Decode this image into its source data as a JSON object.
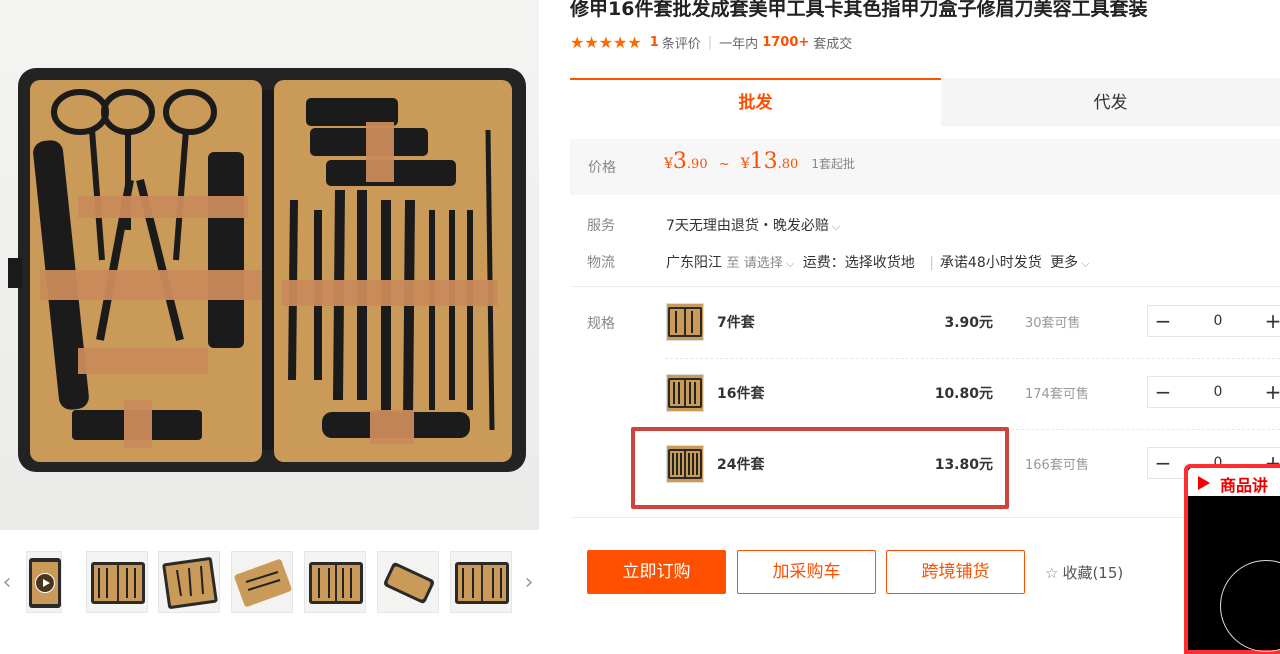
{
  "product": {
    "title": "修甲16件套批发成套美甲工具卡其色指甲刀盒子修眉刀美容工具套装",
    "stars": "★★★★★",
    "review_count": "1",
    "review_label": "条评价",
    "period": "一年内",
    "deal_count": "1700+",
    "deal_label": "套成交"
  },
  "tabs": [
    {
      "label": "批发",
      "active": true
    },
    {
      "label": "代发",
      "active": false
    }
  ],
  "price": {
    "label": "价格",
    "currency": "¥",
    "min_int": "3",
    "min_dec": ".90",
    "tilde": "~",
    "max_int": "13",
    "max_dec": ".80",
    "min_order": "1套起批"
  },
  "service": {
    "label": "服务",
    "value": "7天无理由退货・晚发必赔"
  },
  "logistics": {
    "label": "物流",
    "origin": "广东阳江",
    "to": "至",
    "select": "请选择",
    "freight": "运费：选择收货地",
    "promise": "承诺48小时发货",
    "more": "更多"
  },
  "spec": {
    "label": "规格",
    "items": [
      {
        "name": "7件套",
        "price": "3.90元",
        "stock": "30套可售",
        "qty": "0"
      },
      {
        "name": "16件套",
        "price": "10.80元",
        "stock": "174套可售",
        "qty": "0"
      },
      {
        "name": "24件套",
        "price": "13.80元",
        "stock": "166套可售",
        "qty": "0"
      }
    ],
    "minus": "−",
    "plus": "+"
  },
  "actions": {
    "buy": "立即订购",
    "cart": "加采购车",
    "distribute": "跨境铺货",
    "favorite": "收藏(15)"
  },
  "video_widget": {
    "label": "商品讲"
  },
  "gallery": {
    "prev": "‹",
    "next": "›"
  },
  "colors": {
    "accent": "#ff5000",
    "highlight_border": "#d0443c",
    "case_leather": "#c99a58",
    "case_frame": "#2b2b2b"
  }
}
